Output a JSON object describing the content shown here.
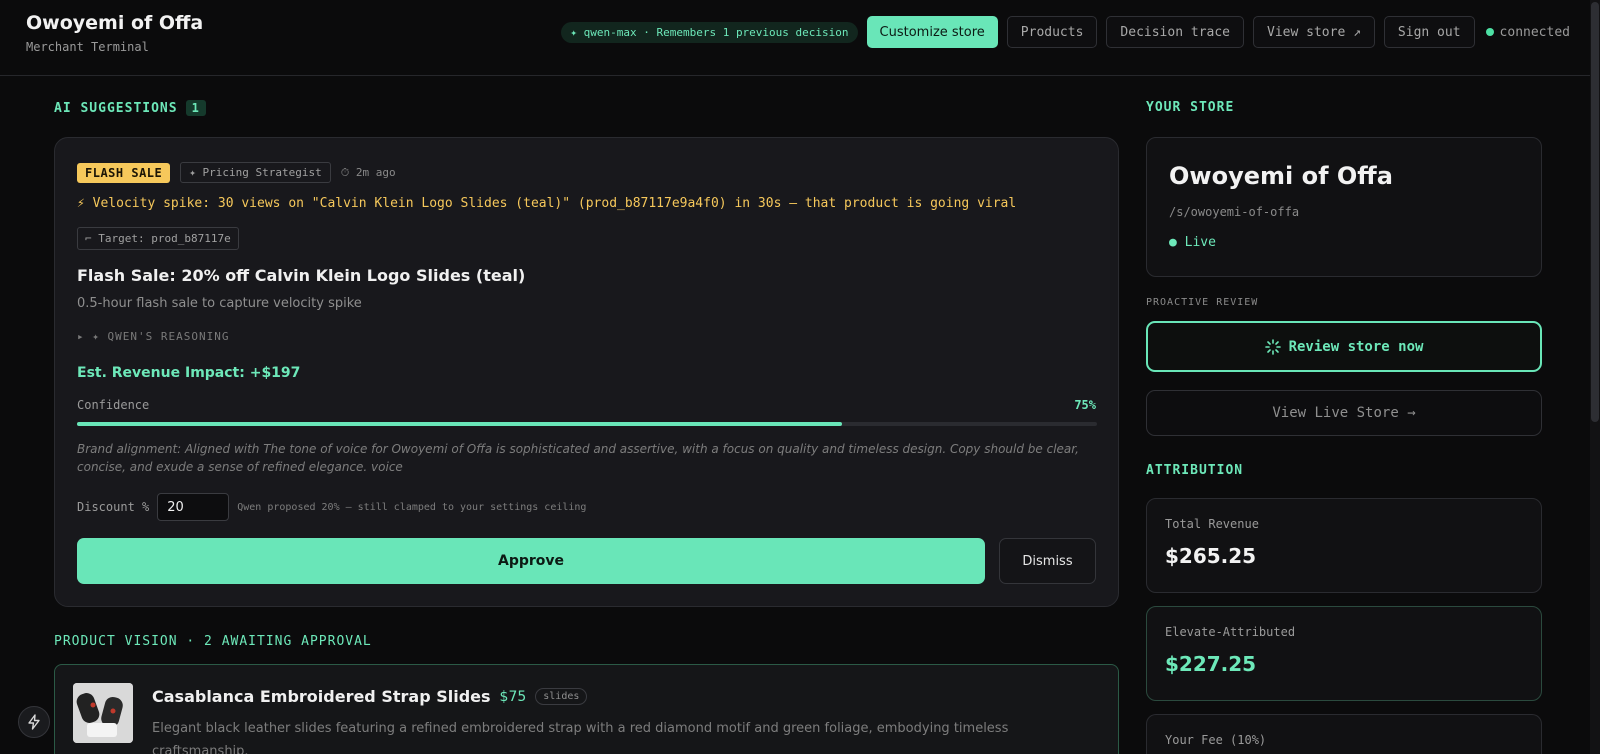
{
  "header": {
    "title": "Owoyemi of Offa",
    "subtitle": "Merchant Terminal",
    "model_pill": "✦ qwen-max · Remembers 1 previous decision",
    "customize_label": "Customize store",
    "products_label": "Products",
    "trace_label": "Decision trace",
    "view_store_label": "View store ↗",
    "signout_label": "Sign out",
    "status_label": "connected"
  },
  "suggestions": {
    "heading": "AI SUGGESTIONS",
    "count": "1",
    "card": {
      "tag": "FLASH SALE",
      "role": "✦ Pricing Strategist",
      "time": "⏱ 2m ago",
      "alert": "⚡ Velocity spike: 30 views on \"Calvin Klein Logo Slides (teal)\" (prod_b87117e9a4f0) in 30s — that product is going viral",
      "target": "⌐ Target: prod_b87117e",
      "title": "Flash Sale: 20% off Calvin Klein Logo Slides (teal)",
      "subtitle": "0.5-hour flash sale to capture velocity spike",
      "reasoning": "▸ ✦ QWEN'S REASONING",
      "impact": "Est. Revenue Impact: +$197",
      "confidence_label": "Confidence",
      "confidence_text": "75%",
      "confidence_value": 0.75,
      "brand_note": "Brand alignment: Aligned with The tone of voice for Owoyemi of Offa is sophisticated and assertive, with a focus on quality and timeless design. Copy should be clear, concise, and exude a sense of refined elegance. voice",
      "discount_label": "Discount %",
      "discount_value": "20",
      "discount_hint": "Qwen proposed 20% — still clamped to your settings ceiling",
      "approve_label": "Approve",
      "dismiss_label": "Dismiss"
    }
  },
  "product_vision": {
    "heading": "PRODUCT VISION · 2 AWAITING APPROVAL",
    "item": {
      "name": "Casablanca Embroidered Strap Slides",
      "price": "$75",
      "tag": "slides",
      "description": "Elegant black leather slides featuring a refined embroidered strap with a red diamond motif and green foliage, embodying timeless craftsmanship."
    }
  },
  "your_store": {
    "heading": "YOUR STORE",
    "name": "Owoyemi of Offa",
    "slug": "/s/owoyemi-of-offa",
    "status": "● Live",
    "proactive_label": "PROACTIVE REVIEW",
    "review_label": "Review store now",
    "view_live_label": "View Live Store →"
  },
  "attribution": {
    "heading": "ATTRIBUTION",
    "total_label": "Total Revenue",
    "total_value": "$265.25",
    "elevate_label": "Elevate-Attributed",
    "elevate_value": "$227.25",
    "fee_label": "Your Fee (10%)"
  },
  "colors": {
    "accent": "#69e6b8",
    "warning": "#f6c85b",
    "background": "#0b0b0c",
    "card": "#18181c"
  }
}
